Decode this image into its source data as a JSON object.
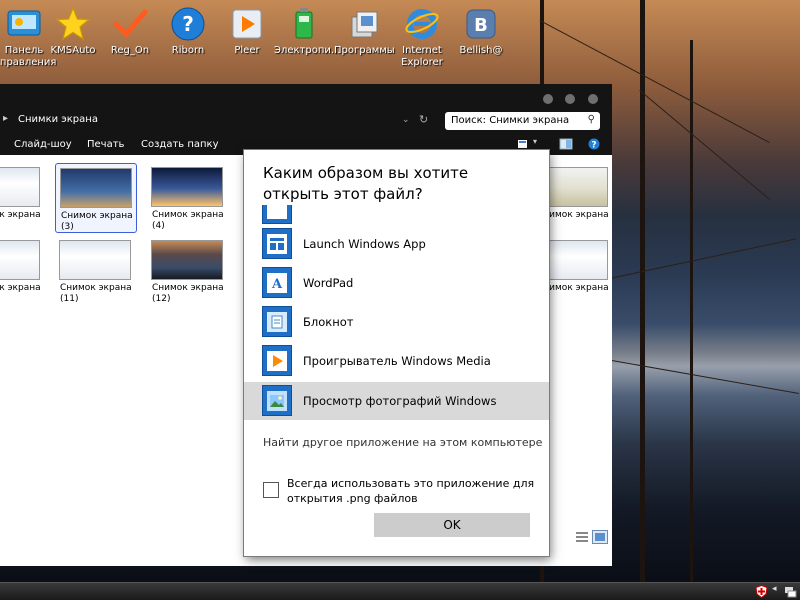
{
  "desktop": {
    "icons": [
      {
        "label": "Панель\nуправления",
        "icon": "control-panel-icon"
      },
      {
        "label": "KMSAuto",
        "icon": "star-icon"
      },
      {
        "label": "Reg_On",
        "icon": "checkmark-icon"
      },
      {
        "label": "Riborn",
        "icon": "help-icon"
      },
      {
        "label": "Pleer",
        "icon": "media-player-icon"
      },
      {
        "label": "Электропи...",
        "icon": "battery-icon"
      },
      {
        "label": "Программы",
        "icon": "programs-icon"
      },
      {
        "label": "Internet\nExplorer",
        "icon": "internet-explorer-icon"
      },
      {
        "label": "Bellish@",
        "icon": "vk-icon"
      }
    ]
  },
  "explorer": {
    "breadcrumb": "Снимки экрана",
    "search_placeholder": "Поиск: Снимки экрана",
    "toolbar": {
      "slideshow": "Слайд-шоу",
      "print": "Печать",
      "new_folder": "Создать папку"
    },
    "thumbnails": [
      {
        "line1": "Снимок экрана",
        "line2": ""
      },
      {
        "line1": "Снимок экрана",
        "line2": "(3)"
      },
      {
        "line1": "Снимок экрана",
        "line2": "(4)"
      },
      {
        "line1": "Снимок экрана",
        "line2": ""
      },
      {
        "line1": "Снимок экрана",
        "line2": "(11)"
      },
      {
        "line1": "Снимок экрана",
        "line2": "(12)"
      },
      {
        "line1": "Снимок экрана",
        "line2": ""
      },
      {
        "line1": "Снимок экрана",
        "line2": ""
      }
    ]
  },
  "dialog": {
    "title": "Каким образом вы хотите открыть этот файл?",
    "apps": [
      {
        "label": "Launch Windows App",
        "icon": "windows-app-icon"
      },
      {
        "label": "WordPad",
        "icon": "wordpad-icon"
      },
      {
        "label": "Блокнот",
        "icon": "notepad-icon"
      },
      {
        "label": "Проигрыватель Windows Media",
        "icon": "windows-media-icon"
      },
      {
        "label": "Просмотр фотографий Windows",
        "icon": "photo-viewer-icon"
      }
    ],
    "find_other": "Найти другое приложение на этом компьютере",
    "always_use": "Всегда использовать это приложение для открытия .png файлов",
    "ok": "OK"
  },
  "colors": {
    "selection_border": "#3d5edb",
    "app_tile_blue": "#1f6fc6",
    "highlight_row": "#d9d9d9"
  }
}
